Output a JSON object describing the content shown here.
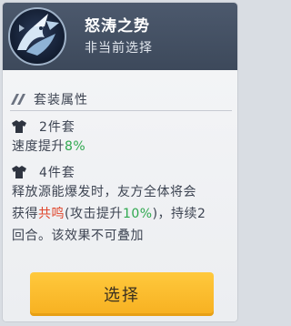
{
  "header": {
    "title": "怒涛之势",
    "subtitle": "非当前选择",
    "emblem_icon": "ice-dragon-emblem-icon"
  },
  "set_attributes": {
    "section_title": "套装属性",
    "two_piece": {
      "label": "2件套",
      "desc_prefix": "速度提升",
      "desc_value": "8%"
    },
    "four_piece": {
      "label": "4件套",
      "desc_line1": "释放源能爆发时，友方全体将会",
      "desc_part_a": "获得",
      "desc_buff": "共鸣",
      "desc_part_b": "(攻击提升",
      "desc_value": "10%",
      "desc_part_c": ")，持续2",
      "desc_line3": "回合。该效果不可叠加"
    }
  },
  "select_button": {
    "label": "选择"
  },
  "colors": {
    "header_bg": "#46536a",
    "highlight_green": "#2fa84f",
    "highlight_red": "#e0452b",
    "button_yellow": "#ffc12f"
  }
}
